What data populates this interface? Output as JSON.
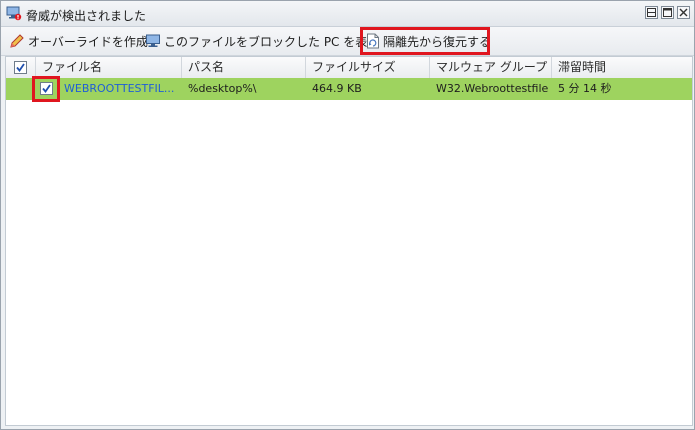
{
  "window": {
    "title": "脅威が検出されました",
    "title_icon": "computer-alert-icon",
    "controls": [
      "restore-icon",
      "maximize-icon",
      "close-icon"
    ]
  },
  "toolbar": {
    "override_label": "オーバーライドを作成",
    "show_pcs_label": "このファイルをブロックした PC を表示",
    "restore_label": "隔離先から復元する",
    "highlight_color": "#e0161f"
  },
  "grid": {
    "columns": [
      "ファイル名",
      "パス名",
      "ファイルサイズ",
      "マルウェア グループ",
      "滞留時間"
    ],
    "header_checkbox_checked": true,
    "rows": [
      {
        "checked": true,
        "file_name": "WEBROOTTESTFIL...",
        "path": "%desktop%\\",
        "size": "464.9 KB",
        "malware_group": "W32.Webroottestfile",
        "dwell_time": "5 分 14 秒"
      }
    ],
    "selected_row_color": "#9ed35f",
    "link_color": "#1f5fd6"
  }
}
